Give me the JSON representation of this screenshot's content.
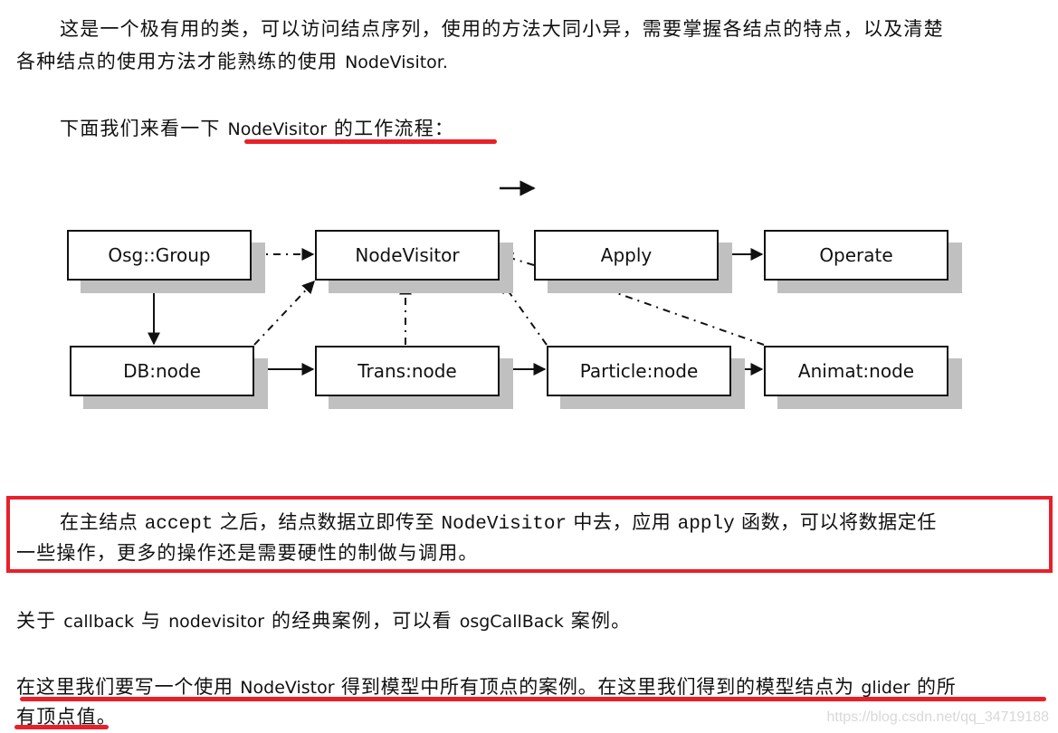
{
  "paragraph1": {
    "line1": "这是一个极有用的类，可以访问结点序列，使用的方法大同小异，需要掌握各结点的特点，以及清楚",
    "line2_cn": "各种结点的使用方法才能熟练的使用",
    "line2_latin": "NodeVisitor."
  },
  "paragraph2": {
    "prefix": "下面我们来看一下",
    "latin": "NodeVisitor",
    "suffix": "的工作流程："
  },
  "diagram": {
    "nodes": {
      "osg_group": "Osg::Group",
      "node_visitor": "NodeVisitor",
      "apply": "Apply",
      "operate": "Operate",
      "db_node": "DB:node",
      "trans_node": "Trans:node",
      "particle_node": "Particle:node",
      "animat_node": "Animat:node"
    }
  },
  "highlight_box": {
    "l1_a": "在主结点",
    "l1_b": "accept",
    "l1_c": "之后，结点数据立即传至",
    "l1_d": "NodeVisitor",
    "l1_e": "中去，应用",
    "l1_f": "apply",
    "l1_g": "函数，可以将数据定任",
    "l2": "一些操作，更多的操作还是需要硬性的制做与调用。"
  },
  "paragraph3": {
    "a": "关于",
    "b": "callback",
    "c": "与",
    "d": "nodevisitor",
    "e": "的经典案例，可以看",
    "f": "osgCallBack",
    "g": "案例。"
  },
  "paragraph4": {
    "a": "在这里我们要写一个使用",
    "b": "NodeVistor",
    "c": "得到模型中所有顶点的案例。在这里我们得到的模型结点为",
    "d": "glider",
    "e": "的所",
    "line2": "有顶点值。"
  },
  "watermark": "https://blog.csdn.net/qq_34719188",
  "colors": {
    "highlight": "#e8202a",
    "shadow": "#c0c0c0",
    "text": "#111111"
  }
}
